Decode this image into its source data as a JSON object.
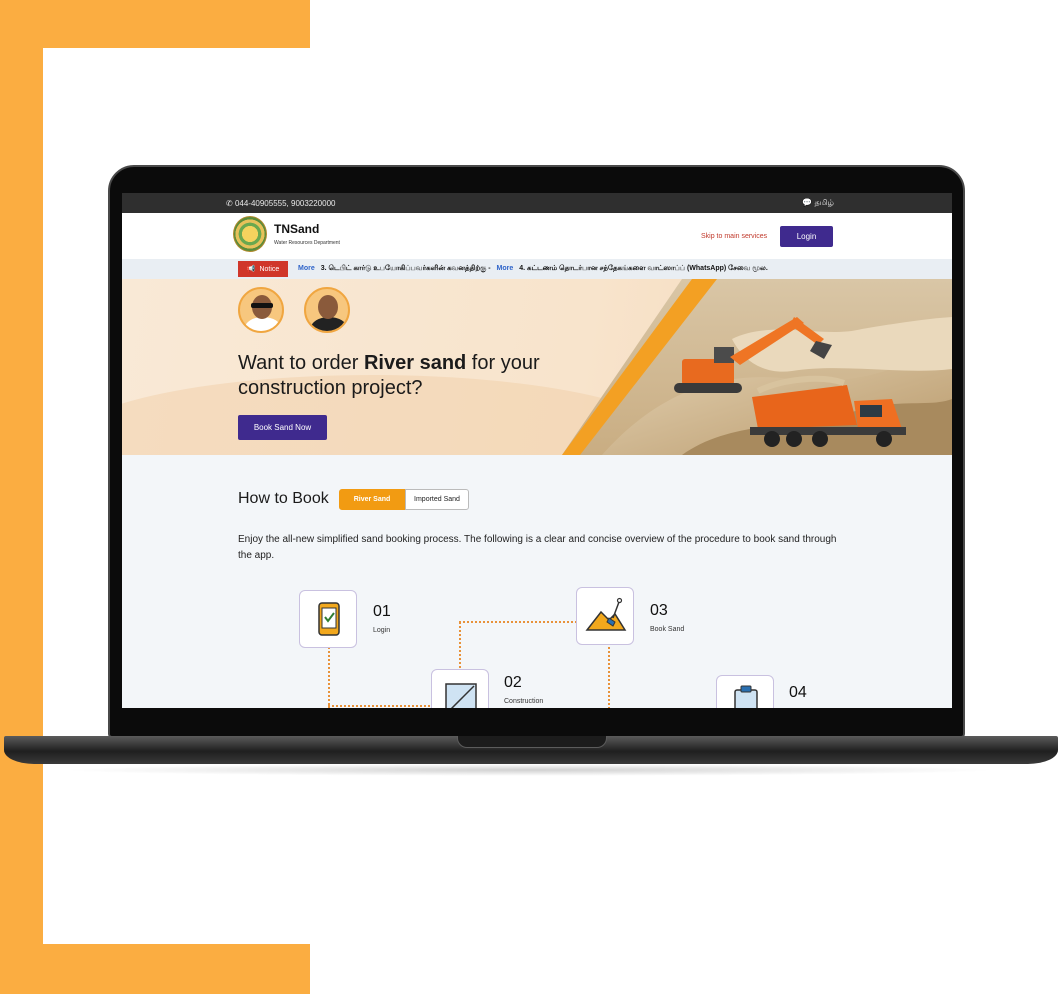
{
  "topbar": {
    "phone": "044-40905555, 9003220000",
    "language": "தமிழ்"
  },
  "header": {
    "brand": "TNSand",
    "department": "Water Resources Department",
    "skip_link": "Skip to main services",
    "login_label": "Login"
  },
  "notice": {
    "tag": "Notice",
    "items": [
      {
        "more": "More",
        "text": "3. டெபிட் கார்டு உபயோகிப்பவர்களின் கவனத்திற்கு -"
      },
      {
        "more": "More",
        "text": "4. கட்டணம் தொடர்பான சந்தேகங்களை வாட்ஸாப்ப் (WhatsApp) சேவை மூல."
      }
    ]
  },
  "hero": {
    "title_pre": "Want to order ",
    "title_bold": "River sand",
    "title_post": " for your construction project?",
    "cta": "Book Sand Now"
  },
  "how_to_book": {
    "title": "How to Book",
    "tabs": [
      {
        "label": "River Sand",
        "active": true
      },
      {
        "label": "Imported Sand",
        "active": false
      }
    ],
    "description": "Enjoy the all-new simplified sand booking process. The following is a clear and concise overview of the procedure to book sand through the app.",
    "steps": [
      {
        "number": "01",
        "label": "Login",
        "icon": "phone-checkbox-icon"
      },
      {
        "number": "02",
        "label": "Construction",
        "icon": "construction-icon"
      },
      {
        "number": "03",
        "label": "Book Sand",
        "icon": "sand-shovel-icon"
      },
      {
        "number": "04",
        "label": "",
        "icon": "clipboard-icon"
      }
    ]
  },
  "colors": {
    "accent_orange": "#fbad41",
    "primary_purple": "#3f2a8e",
    "notice_red": "#d0362a",
    "tab_orange": "#f29b12"
  }
}
